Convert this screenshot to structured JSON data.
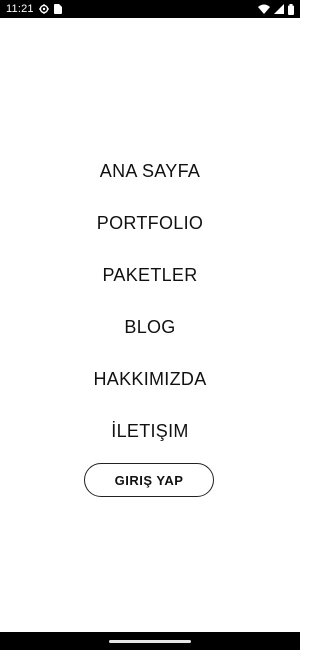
{
  "status_bar": {
    "time": "11:21",
    "icons": [
      "settings-gear-icon",
      "sim-card-icon",
      "wifi-icon",
      "cellular-signal-icon",
      "battery-icon"
    ]
  },
  "menu": {
    "items": [
      {
        "label": "ANA SAYFA"
      },
      {
        "label": "PORTFOLIO"
      },
      {
        "label": "PAKETLER"
      },
      {
        "label": "BLOG"
      },
      {
        "label": "HAKKIMIZDA"
      },
      {
        "label": "İLETIŞIM"
      }
    ]
  },
  "login_button": {
    "label": "GIRIŞ YAP"
  },
  "colors": {
    "background": "#ffffff",
    "text": "#111111",
    "system_bars": "#000000"
  }
}
